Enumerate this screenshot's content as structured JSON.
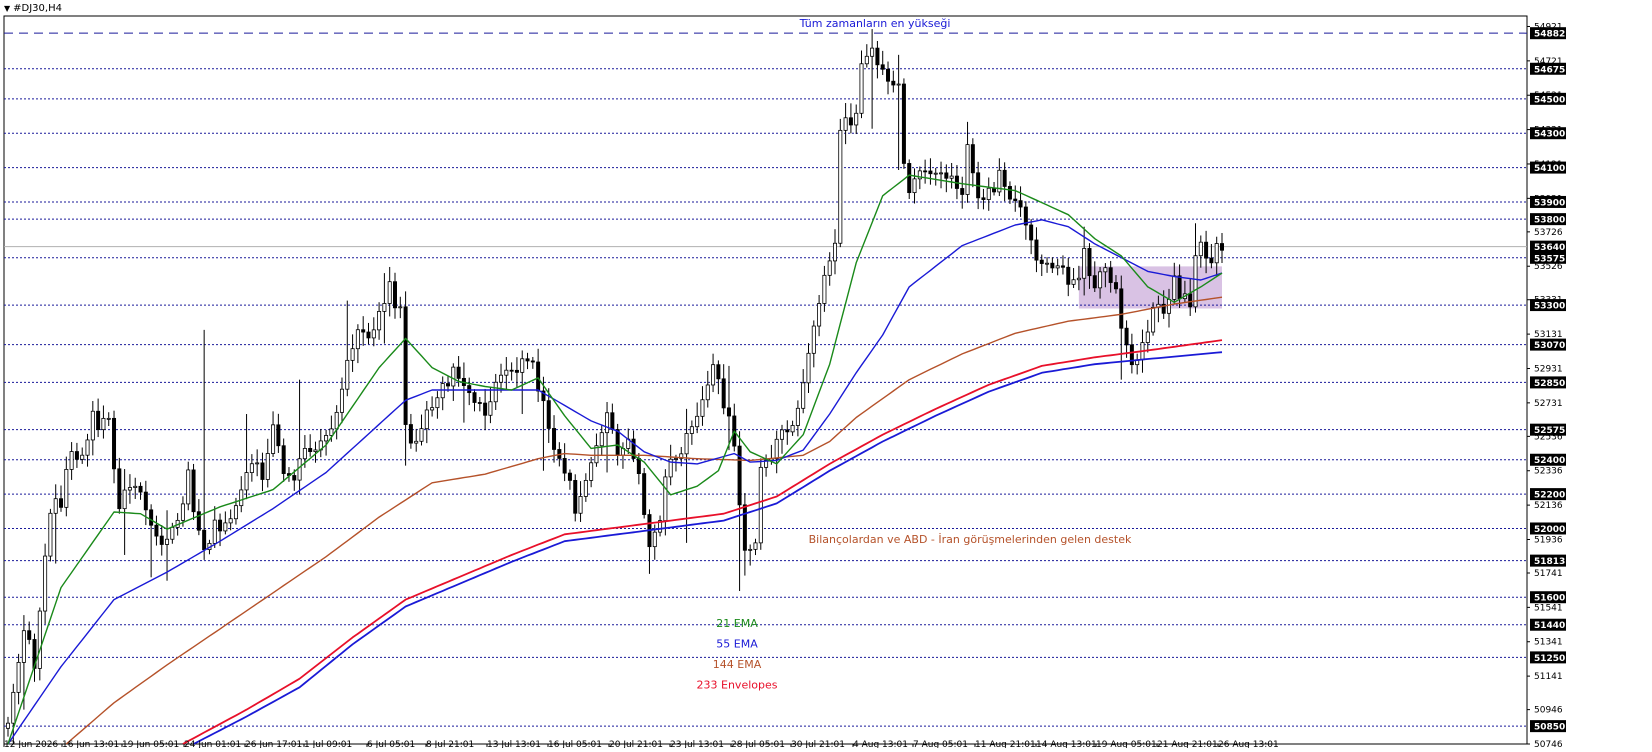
{
  "symbol": "#DJ30,H4",
  "chart_data": {
    "type": "candlestick",
    "y_range": [
      50746,
      54982
    ],
    "price_axis_labels": [
      "54921",
      "54721",
      "54521",
      "54321",
      "54121",
      "53921",
      "53726",
      "53526",
      "53331",
      "53131",
      "52931",
      "52731",
      "52536",
      "52336",
      "52136",
      "51936",
      "51741",
      "51541",
      "51341",
      "51141",
      "50946",
      "50746"
    ],
    "horizontal_levels": [
      {
        "value": 54882,
        "label": "54882",
        "style": "long-dash"
      },
      {
        "value": 54675,
        "label": "54675",
        "style": "dotted"
      },
      {
        "value": 54500,
        "label": "54500",
        "style": "dotted"
      },
      {
        "value": 54300,
        "label": "54300",
        "style": "dotted"
      },
      {
        "value": 54100,
        "label": "54100",
        "style": "dotted"
      },
      {
        "value": 53900,
        "label": "53900",
        "style": "dotted"
      },
      {
        "value": 53800,
        "label": "53800",
        "style": "dotted"
      },
      {
        "value": 53575,
        "label": "53575",
        "style": "dotted"
      },
      {
        "value": 53300,
        "label": "53300",
        "style": "dotted"
      },
      {
        "value": 53070,
        "label": "53070",
        "style": "dotted"
      },
      {
        "value": 52850,
        "label": "52850",
        "style": "dotted"
      },
      {
        "value": 52575,
        "label": "52575",
        "style": "dotted"
      },
      {
        "value": 52400,
        "label": "52400",
        "style": "dotted"
      },
      {
        "value": 52200,
        "label": "52200",
        "style": "dotted"
      },
      {
        "value": 52000,
        "label": "52000",
        "style": "dotted"
      },
      {
        "value": 51813,
        "label": "51813",
        "style": "dotted"
      },
      {
        "value": 51600,
        "label": "51600",
        "style": "dotted"
      },
      {
        "value": 51440,
        "label": "51440",
        "style": "dotted"
      },
      {
        "value": 51250,
        "label": "51250",
        "style": "dotted"
      },
      {
        "value": 50850,
        "label": "50850",
        "style": "dotted"
      }
    ],
    "current_price": {
      "value": 53640,
      "label": "53640"
    },
    "time_labels": [
      "12 Jun 2026",
      "16 Jun 13:01",
      "19 Jun 05:01",
      "24 Jun 01:01",
      "26 Jun 17:01",
      "1 Jul 09:01",
      "6 Jul 05:01",
      "8 Jul 21:01",
      "13 Jul 13:01",
      "16 Jul 05:01",
      "20 Jul 21:01",
      "23 Jul 13:01",
      "28 Jul 05:01",
      "30 Jul 21:01",
      "4 Aug 13:01",
      "7 Aug 05:01",
      "11 Aug 21:01",
      "14 Aug 13:01",
      "19 Aug 05:01",
      "21 Aug 21:01",
      "26 Aug 13:01"
    ],
    "annotations": [
      {
        "text": "Tüm zamanların en yükseği",
        "color": "#1a1ad6"
      },
      {
        "text": "Bilançolardan ve ABD - İran görüşmelerinden gelen destek",
        "color": "#b5522a"
      }
    ],
    "legend": [
      {
        "text": "21 EMA",
        "color": "#1a8a1a"
      },
      {
        "text": "55 EMA",
        "color": "#1a1ad6"
      },
      {
        "text": "144 EMA",
        "color": "#b5522a"
      },
      {
        "text": "233 Envelopes",
        "color": "#e8102a"
      }
    ],
    "highlight_zone": {
      "y_top": 53525,
      "y_bottom": 53280,
      "color": "#c9a8d8"
    },
    "close_path": [
      [
        0,
        50846
      ],
      [
        3,
        51446
      ],
      [
        5,
        51196
      ],
      [
        8,
        52126
      ],
      [
        10,
        52146
      ],
      [
        12,
        52456
      ],
      [
        14,
        52406
      ],
      [
        16,
        52676
      ],
      [
        17,
        52606
      ],
      [
        19,
        52636
      ],
      [
        21,
        52126
      ],
      [
        24,
        52286
      ],
      [
        27,
        51996
      ],
      [
        29,
        51866
      ],
      [
        32,
        52046
      ],
      [
        34,
        52296
      ],
      [
        35,
        52086
      ],
      [
        37,
        51856
      ],
      [
        39,
        52006
      ],
      [
        42,
        52066
      ],
      [
        44,
        52206
      ],
      [
        46,
        52386
      ],
      [
        48,
        52326
      ],
      [
        50,
        52596
      ],
      [
        52,
        52356
      ],
      [
        54,
        52326
      ],
      [
        56,
        52426
      ],
      [
        58,
        52496
      ],
      [
        60,
        52536
      ],
      [
        62,
        52696
      ],
      [
        64,
        52996
      ],
      [
        66,
        53126
      ],
      [
        68,
        53086
      ],
      [
        70,
        53226
      ],
      [
        71,
        53296
      ],
      [
        72,
        53406
      ],
      [
        74,
        53246
      ],
      [
        75,
        52586
      ],
      [
        76,
        52496
      ],
      [
        79,
        52646
      ],
      [
        82,
        52846
      ],
      [
        84,
        52896
      ],
      [
        87,
        52776
      ],
      [
        90,
        52686
      ],
      [
        93,
        52866
      ],
      [
        96,
        52936
      ],
      [
        99,
        52976
      ],
      [
        101,
        52706
      ],
      [
        103,
        52466
      ],
      [
        105,
        52366
      ],
      [
        107,
        52126
      ],
      [
        109,
        52266
      ],
      [
        111,
        52446
      ],
      [
        113,
        52656
      ],
      [
        115,
        52416
      ],
      [
        117,
        52536
      ],
      [
        119,
        52316
      ],
      [
        121,
        51926
      ],
      [
        123,
        52026
      ],
      [
        124,
        52296
      ],
      [
        126,
        52426
      ],
      [
        128,
        52526
      ],
      [
        130,
        52686
      ],
      [
        133,
        52926
      ],
      [
        135,
        52746
      ],
      [
        137,
        52476
      ],
      [
        138,
        52106
      ],
      [
        139,
        51846
      ],
      [
        141,
        51916
      ],
      [
        142,
        52386
      ],
      [
        144,
        52436
      ],
      [
        146,
        52546
      ],
      [
        148,
        52636
      ],
      [
        150,
        52836
      ],
      [
        152,
        53176
      ],
      [
        154,
        53496
      ],
      [
        156,
        53696
      ],
      [
        157,
        54276
      ],
      [
        158,
        54346
      ],
      [
        160,
        54416
      ],
      [
        161,
        54696
      ],
      [
        163,
        54806
      ],
      [
        164,
        54666
      ],
      [
        166,
        54626
      ],
      [
        168,
        54556
      ],
      [
        169,
        54136
      ],
      [
        170,
        53976
      ],
      [
        172,
        54066
      ],
      [
        174,
        54046
      ],
      [
        176,
        54086
      ],
      [
        178,
        54006
      ],
      [
        180,
        53926
      ],
      [
        181,
        54266
      ],
      [
        183,
        53906
      ],
      [
        185,
        53956
      ],
      [
        187,
        54046
      ],
      [
        189,
        53936
      ],
      [
        191,
        53846
      ],
      [
        193,
        53636
      ],
      [
        195,
        53546
      ],
      [
        197,
        53496
      ],
      [
        199,
        53526
      ],
      [
        200,
        53386
      ],
      [
        202,
        53456
      ],
      [
        203,
        53586
      ],
      [
        205,
        53426
      ],
      [
        207,
        53506
      ],
      [
        209,
        53366
      ],
      [
        210,
        53166
      ],
      [
        212,
        52966
      ],
      [
        214,
        53046
      ],
      [
        216,
        53256
      ],
      [
        218,
        53286
      ],
      [
        220,
        53426
      ],
      [
        221,
        53366
      ],
      [
        223,
        53326
      ],
      [
        224,
        53576
      ],
      [
        225,
        53646
      ],
      [
        227,
        53576
      ],
      [
        228,
        53666
      ],
      [
        229,
        53646
      ]
    ],
    "ema21_path": [
      [
        0,
        50746
      ],
      [
        10,
        51656
      ],
      [
        20,
        52096
      ],
      [
        25,
        52086
      ],
      [
        30,
        51996
      ],
      [
        40,
        52126
      ],
      [
        50,
        52226
      ],
      [
        60,
        52486
      ],
      [
        70,
        52936
      ],
      [
        75,
        53106
      ],
      [
        80,
        52936
      ],
      [
        85,
        52856
      ],
      [
        90,
        52826
      ],
      [
        95,
        52806
      ],
      [
        100,
        52876
      ],
      [
        105,
        52656
      ],
      [
        110,
        52466
      ],
      [
        115,
        52486
      ],
      [
        120,
        52386
      ],
      [
        125,
        52196
      ],
      [
        130,
        52246
      ],
      [
        134,
        52336
      ],
      [
        137,
        52566
      ],
      [
        140,
        52446
      ],
      [
        145,
        52376
      ],
      [
        150,
        52546
      ],
      [
        155,
        52956
      ],
      [
        160,
        53546
      ],
      [
        165,
        53936
      ],
      [
        170,
        54056
      ],
      [
        180,
        54006
      ],
      [
        190,
        53966
      ],
      [
        200,
        53826
      ],
      [
        205,
        53686
      ],
      [
        210,
        53586
      ],
      [
        215,
        53406
      ],
      [
        220,
        53316
      ],
      [
        225,
        53406
      ],
      [
        229,
        53486
      ]
    ],
    "ema55_path": [
      [
        0,
        50746
      ],
      [
        10,
        51196
      ],
      [
        20,
        51586
      ],
      [
        30,
        51746
      ],
      [
        40,
        51926
      ],
      [
        50,
        52116
      ],
      [
        60,
        52326
      ],
      [
        70,
        52606
      ],
      [
        75,
        52746
      ],
      [
        80,
        52806
      ],
      [
        90,
        52806
      ],
      [
        100,
        52806
      ],
      [
        110,
        52626
      ],
      [
        115,
        52566
      ],
      [
        120,
        52446
      ],
      [
        125,
        52386
      ],
      [
        130,
        52376
      ],
      [
        137,
        52436
      ],
      [
        140,
        52386
      ],
      [
        145,
        52396
      ],
      [
        150,
        52456
      ],
      [
        155,
        52666
      ],
      [
        160,
        52906
      ],
      [
        165,
        53126
      ],
      [
        170,
        53406
      ],
      [
        180,
        53646
      ],
      [
        185,
        53706
      ],
      [
        190,
        53766
      ],
      [
        195,
        53796
      ],
      [
        200,
        53756
      ],
      [
        205,
        53656
      ],
      [
        210,
        53576
      ],
      [
        215,
        53496
      ],
      [
        220,
        53466
      ],
      [
        225,
        53446
      ],
      [
        229,
        53486
      ]
    ],
    "ema144_path": [
      [
        11,
        50746
      ],
      [
        20,
        50986
      ],
      [
        30,
        51206
      ],
      [
        40,
        51416
      ],
      [
        50,
        51626
      ],
      [
        60,
        51836
      ],
      [
        70,
        52066
      ],
      [
        80,
        52266
      ],
      [
        90,
        52316
      ],
      [
        100,
        52406
      ],
      [
        105,
        52436
      ],
      [
        110,
        52426
      ],
      [
        120,
        52426
      ],
      [
        130,
        52406
      ],
      [
        140,
        52396
      ],
      [
        150,
        52426
      ],
      [
        155,
        52506
      ],
      [
        160,
        52646
      ],
      [
        170,
        52866
      ],
      [
        180,
        53016
      ],
      [
        190,
        53136
      ],
      [
        200,
        53206
      ],
      [
        210,
        53246
      ],
      [
        215,
        53276
      ],
      [
        220,
        53306
      ],
      [
        229,
        53346
      ]
    ],
    "env_upper_path": [
      [
        33,
        50746
      ],
      [
        45,
        50946
      ],
      [
        55,
        51126
      ],
      [
        65,
        51366
      ],
      [
        75,
        51586
      ],
      [
        85,
        51716
      ],
      [
        95,
        51846
      ],
      [
        105,
        51966
      ],
      [
        115,
        52006
      ],
      [
        125,
        52046
      ],
      [
        135,
        52086
      ],
      [
        145,
        52186
      ],
      [
        155,
        52376
      ],
      [
        165,
        52546
      ],
      [
        175,
        52696
      ],
      [
        185,
        52836
      ],
      [
        195,
        52946
      ],
      [
        205,
        52996
      ],
      [
        215,
        53036
      ],
      [
        229,
        53096
      ]
    ],
    "env_lower_path": [
      [
        35,
        50746
      ],
      [
        45,
        50906
      ],
      [
        55,
        51076
      ],
      [
        65,
        51326
      ],
      [
        75,
        51546
      ],
      [
        85,
        51676
      ],
      [
        95,
        51806
      ],
      [
        105,
        51926
      ],
      [
        115,
        51966
      ],
      [
        125,
        52006
      ],
      [
        135,
        52046
      ],
      [
        145,
        52146
      ],
      [
        155,
        52336
      ],
      [
        165,
        52506
      ],
      [
        175,
        52656
      ],
      [
        185,
        52796
      ],
      [
        195,
        52906
      ],
      [
        205,
        52956
      ],
      [
        215,
        52986
      ],
      [
        229,
        53026
      ]
    ],
    "spikes": [
      [
        1,
        50846,
        50746
      ],
      [
        3,
        51496,
        50946
      ],
      [
        9,
        52156,
        51796
      ],
      [
        17,
        52756,
        52556
      ],
      [
        22,
        52346,
        51846
      ],
      [
        27,
        52046,
        51716
      ],
      [
        30,
        52106,
        51696
      ],
      [
        37,
        53156,
        51856
      ],
      [
        45,
        52666,
        52176
      ],
      [
        55,
        52866,
        52356
      ],
      [
        64,
        53326,
        52856
      ],
      [
        71,
        53486,
        53076
      ],
      [
        75,
        52896,
        52366
      ],
      [
        86,
        52966,
        52616
      ],
      [
        97,
        53036,
        52666
      ],
      [
        101,
        52716,
        52336
      ],
      [
        113,
        52736,
        52326
      ],
      [
        121,
        52036,
        51736
      ],
      [
        128,
        52696,
        51916
      ],
      [
        136,
        52946,
        52456
      ],
      [
        138,
        52566,
        51636
      ],
      [
        139,
        52206,
        51726
      ],
      [
        157,
        54316,
        53966
      ],
      [
        163,
        54906,
        54326
      ],
      [
        168,
        54756,
        54086
      ],
      [
        181,
        54366,
        53906
      ],
      [
        203,
        53756,
        53356
      ],
      [
        210,
        53446,
        52866
      ],
      [
        224,
        53776,
        53346
      ]
    ]
  }
}
